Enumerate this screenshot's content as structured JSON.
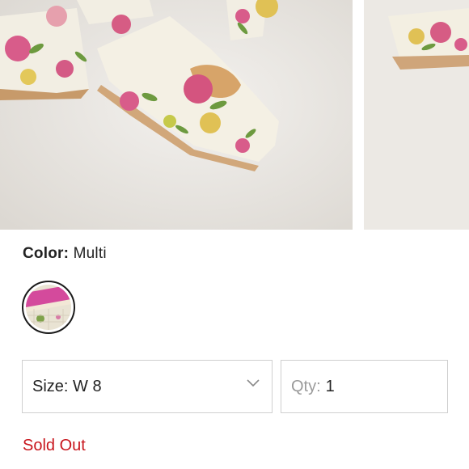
{
  "product_gallery": {
    "images": [
      {
        "alt": "floral platform heel, main view",
        "icon": "floral-shoe-image"
      },
      {
        "alt": "floral platform heel, second view",
        "icon": "floral-shoe-image"
      }
    ]
  },
  "color": {
    "label": "Color:",
    "value": "Multi",
    "swatch_icon": "floral-swatch"
  },
  "size": {
    "label": "Size:",
    "value": "W 8",
    "icon": "chevron-down-icon"
  },
  "quantity": {
    "label": "Qty:",
    "value": "1"
  },
  "status": {
    "text": "Sold Out",
    "color": "#c8161d"
  }
}
